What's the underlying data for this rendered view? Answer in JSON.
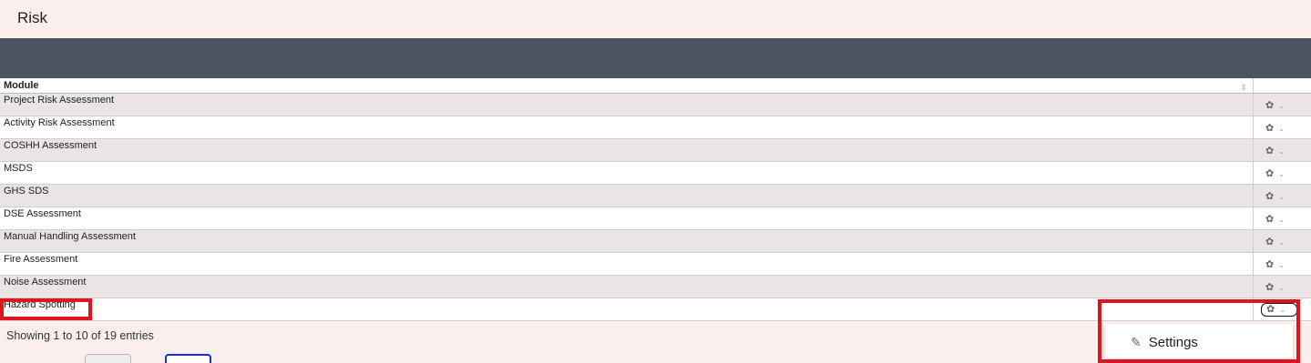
{
  "page": {
    "title": "Risk"
  },
  "table": {
    "header": {
      "module": "Module"
    },
    "rows": [
      "Project Risk Assessment",
      "Activity Risk Assessment",
      "COSHH Assessment",
      "MSDS",
      "GHS SDS",
      "DSE Assessment",
      "Manual Handling Assessment",
      "Fire Assessment",
      "Noise Assessment",
      "Hazard Spotting"
    ],
    "action_icon": "gear-icon",
    "caret_icon": "caret-down-icon"
  },
  "footer": {
    "info": "Showing 1 to 10 of 19 entries"
  },
  "dropdown": {
    "item_label": "Settings",
    "item_icon": "edit-icon"
  },
  "colors": {
    "highlight": "#e0141e",
    "header_bar": "#4a5462",
    "page_bg": "#fbefee"
  }
}
